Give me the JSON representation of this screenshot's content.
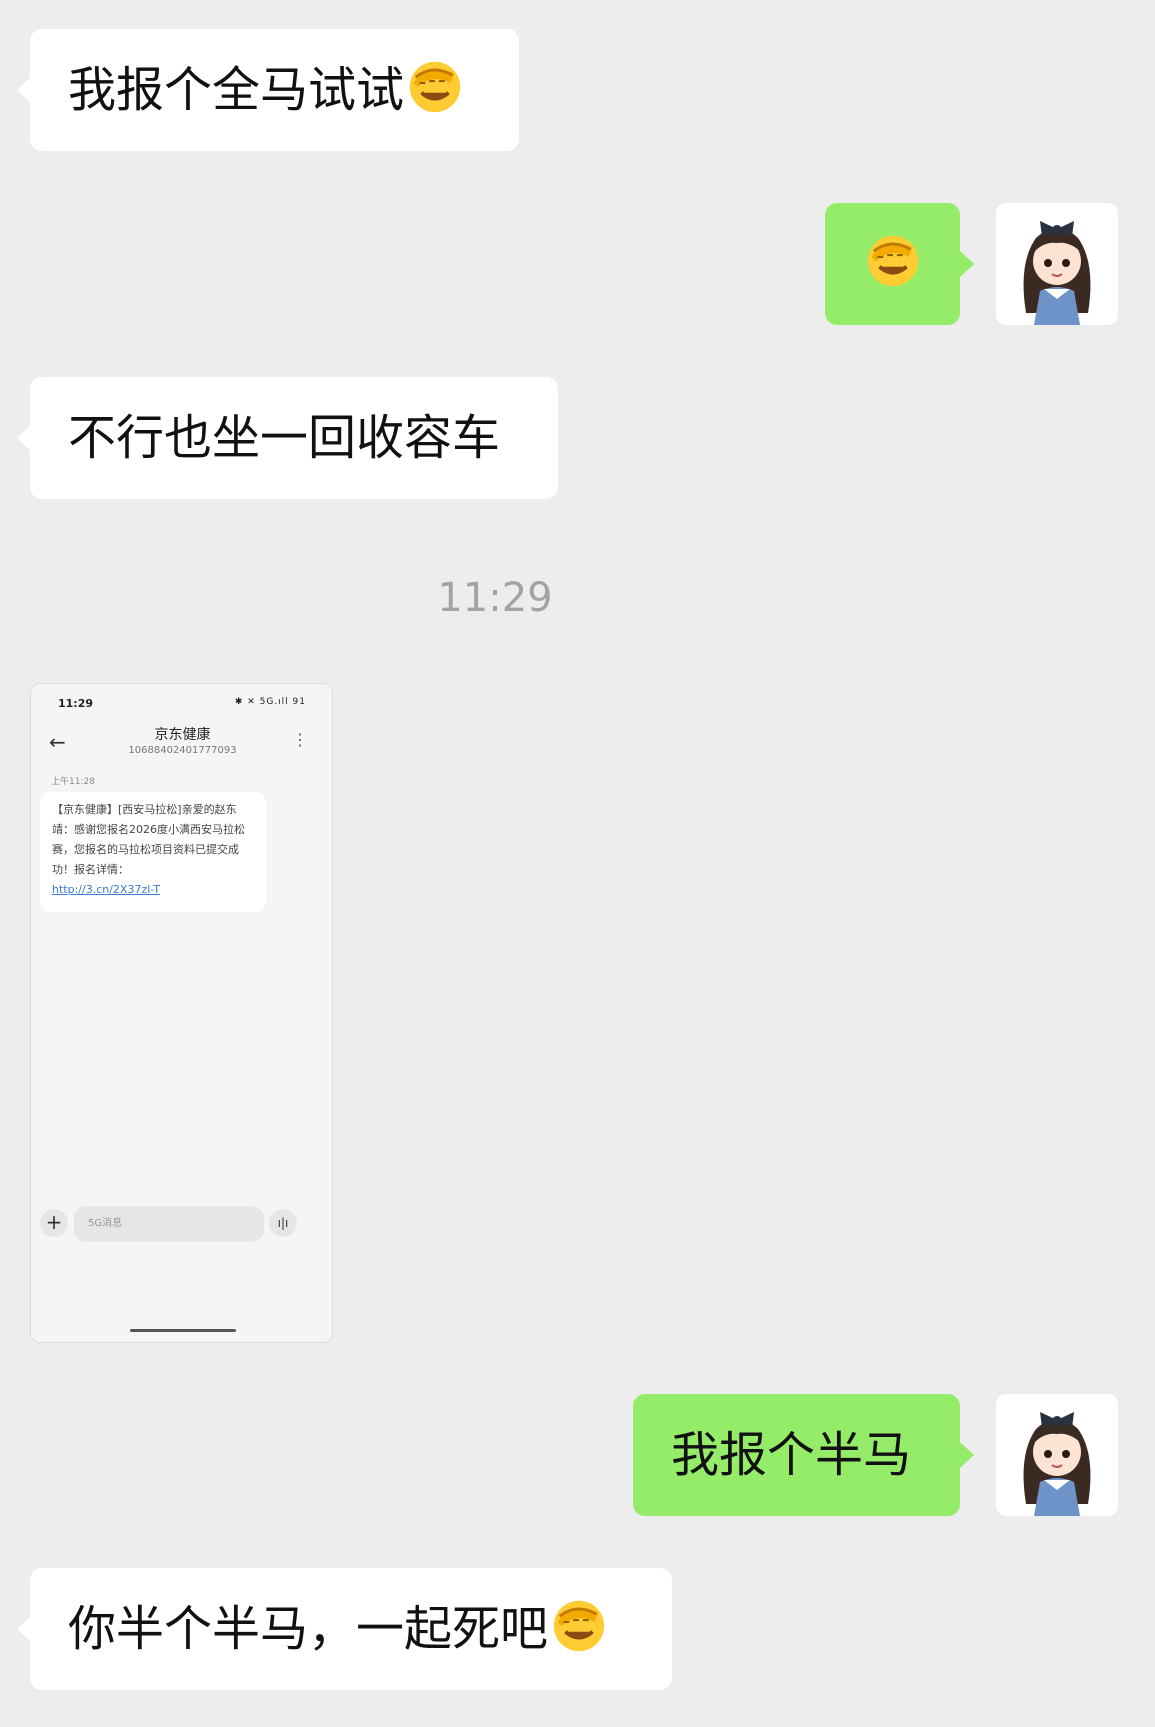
{
  "messages": [
    {
      "from": "other",
      "text": "我报个全马试试",
      "emoji": "facepalm-emoji"
    },
    {
      "from": "me",
      "text": "",
      "emoji": "facepalm-emoji"
    },
    {
      "from": "other",
      "text": "不行也坐一回收容车"
    },
    {
      "from": "me",
      "text": "我报个半马"
    },
    {
      "from": "other",
      "text": "你半个半马，一起死吧",
      "emoji": "facepalm-emoji"
    }
  ],
  "timestamp": "11:29",
  "screenshot": {
    "status_time": "11:29",
    "status_icons": "✱ ✕ 5G.ıll 91",
    "sender_name": "京东健康",
    "sender_number": "10688402401777093",
    "message_time": "上午11:28",
    "sms_text": "【京东健康】[西安马拉松]亲爱的赵东靖：感谢您报名2026度小满西安马拉松赛，您报名的马拉松项目资料已提交成功！报名详情：",
    "sms_link": "http://3.cn/2X37zl-T",
    "input_placeholder": "5G消息"
  },
  "colors": {
    "background": "#ededed",
    "incoming_bubble": "#ffffff",
    "outgoing_bubble": "#95ec69"
  }
}
